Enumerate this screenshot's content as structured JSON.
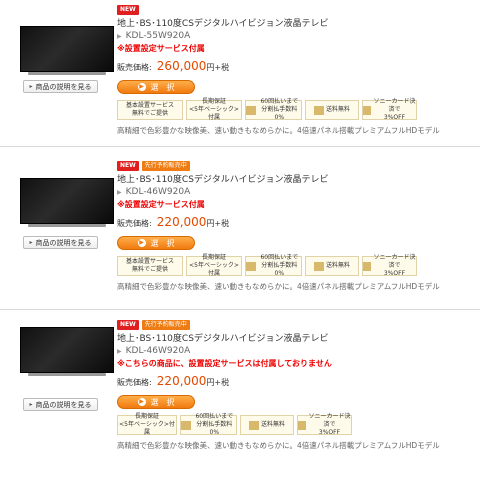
{
  "products": [
    {
      "new": "NEW",
      "title": "地上･BS･110度CSデジタルハイビジョン液晶テレビ",
      "model": "KDL-55W920A",
      "note": "※設置設定サービス付属",
      "price_label": "販売価格:",
      "price": "260,000",
      "unit": "円",
      "tax": "+税",
      "select": "選　択",
      "detail": "商品の説明を見る",
      "badges": [
        "基本設置サービス\n無料でご提供",
        "長期保証\n<5年ベーシック>付属",
        "60回払いまで\n分割払手数料0%",
        "送料無料",
        "ソニーカード決済で\n3%OFF"
      ],
      "desc": "高精細で色彩豊かな映像美、速い動きもなめらかに。4倍速パネル搭載プレミアムフルHDモデル"
    },
    {
      "new": "NEW",
      "pre": "先行予約販売中",
      "title": "地上･BS･110度CSデジタルハイビジョン液晶テレビ",
      "model": "KDL-46W920A",
      "note": "※設置設定サービス付属",
      "price_label": "販売価格:",
      "price": "220,000",
      "unit": "円",
      "tax": "+税",
      "select": "選　択",
      "detail": "商品の説明を見る",
      "badges": [
        "基本設置サービス\n無料でご提供",
        "長期保証\n<5年ベーシック>付属",
        "60回払いまで\n分割払手数料0%",
        "送料無料",
        "ソニーカード決済で\n3%OFF"
      ],
      "desc": "高精細で色彩豊かな映像美、速い動きもなめらかに。4倍速パネル搭載プレミアムフルHDモデル"
    },
    {
      "new": "NEW",
      "pre": "先行予約販売中",
      "title": "地上･BS･110度CSデジタルハイビジョン液晶テレビ",
      "model": "KDL-46W920A",
      "note": "※こちらの商品に、設置設定サービスは付属しておりません",
      "price_label": "販売価格:",
      "price": "220,000",
      "unit": "円",
      "tax": "+税",
      "select": "選　択",
      "detail": "商品の説明を見る",
      "badges": [
        "長期保証\n<5年ベーシック>付属",
        "60回払いまで\n分割払手数料0%",
        "送料無料",
        "ソニーカード決済で\n3%OFF"
      ],
      "desc": "高精細で色彩豊かな映像美、速い動きもなめらかに。4倍速パネル搭載プレミアムフルHDモデル"
    }
  ]
}
